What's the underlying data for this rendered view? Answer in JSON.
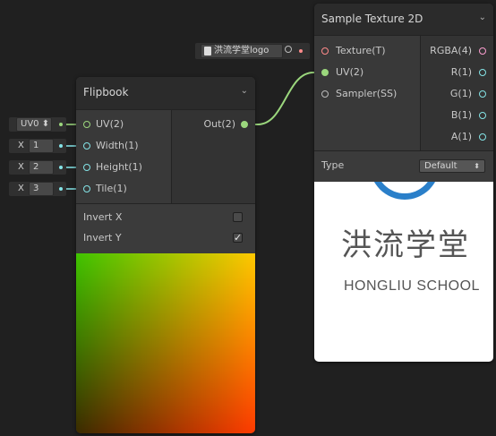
{
  "flipbook": {
    "title": "Flipbook",
    "inputs": [
      {
        "label": "UV(2)",
        "field": "UV0 ⬍",
        "type": "uv"
      },
      {
        "label": "Width(1)",
        "field_prefix": "X",
        "field_value": "1",
        "type": "vec1"
      },
      {
        "label": "Height(1)",
        "field_prefix": "X",
        "field_value": "2",
        "type": "vec1"
      },
      {
        "label": "Tile(1)",
        "field_prefix": "X",
        "field_value": "3",
        "type": "vec1"
      }
    ],
    "output": {
      "label": "Out(2)",
      "type": "uv"
    },
    "settings": [
      {
        "label": "Invert X",
        "checked": false
      },
      {
        "label": "Invert Y",
        "checked": true
      }
    ]
  },
  "sample_texture": {
    "title": "Sample Texture 2D",
    "texture_field": "洪流学堂logo",
    "inputs": [
      {
        "label": "Texture(T)",
        "type": "tex"
      },
      {
        "label": "UV(2)",
        "type": "uv"
      },
      {
        "label": "Sampler(SS)",
        "type": "samp"
      }
    ],
    "outputs": [
      {
        "label": "RGBA(4)",
        "type": "rgba"
      },
      {
        "label": "R(1)",
        "type": "vec1"
      },
      {
        "label": "G(1)",
        "type": "vec1"
      },
      {
        "label": "B(1)",
        "type": "vec1"
      },
      {
        "label": "A(1)",
        "type": "vec1"
      }
    ],
    "type_label": "Type",
    "type_value": "Default",
    "preview": {
      "logo_cn": "洪流学堂",
      "logo_en": "HONGLIU SCHOOL"
    }
  },
  "colors": {
    "canvas": "#202020",
    "node_body": "#393939",
    "uv_green": "#9bd77d",
    "vec1_cyan": "#84e4e7",
    "texture_red": "#ff8b8b",
    "rgba_pink": "#fb9ecf"
  }
}
